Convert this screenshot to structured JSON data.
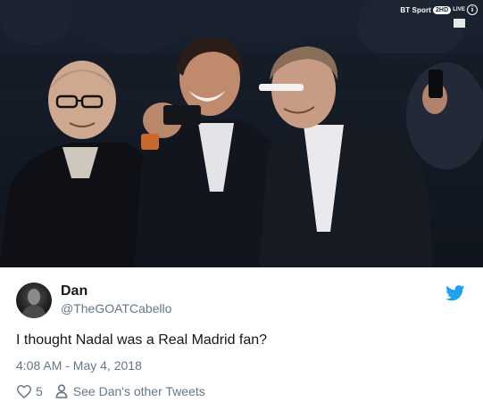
{
  "photo": {
    "broadcast_brand": "BT Sport",
    "broadcast_channel": "2HD",
    "broadcast_live": "LIVE",
    "info_glyph": "i"
  },
  "tweet": {
    "author_name": "Dan",
    "author_handle": "@TheGOATCabello",
    "text": "I thought Nadal was a Real Madrid fan?",
    "timestamp": "4:08 AM - May 4, 2018",
    "like_count": "5",
    "other_tweets_label": "See Dan's other Tweets"
  },
  "colors": {
    "twitter_blue": "#1da1f2",
    "secondary_text": "#657786",
    "primary_text": "#14171a"
  },
  "icons": [
    "heart-icon",
    "person-icon",
    "twitter-bird-icon",
    "info-icon"
  ]
}
